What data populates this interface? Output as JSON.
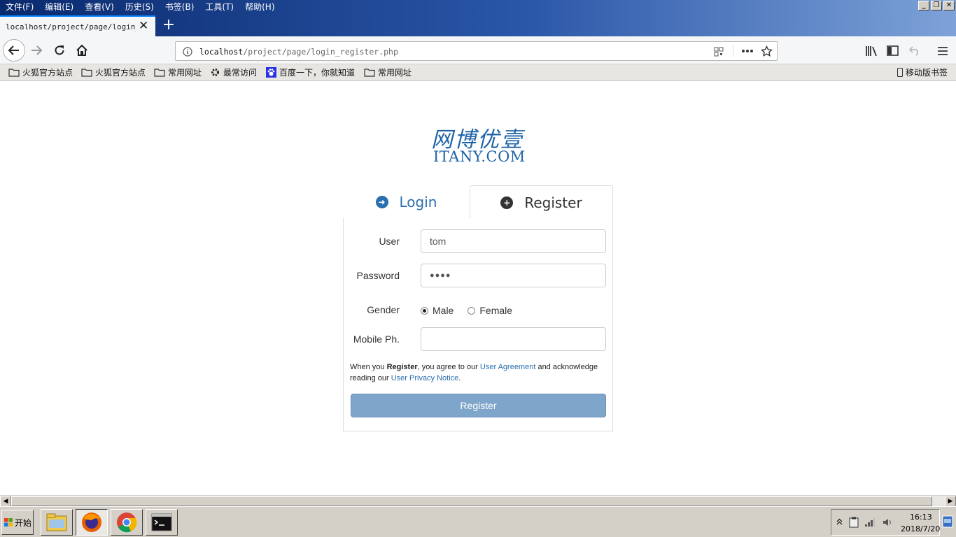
{
  "menu": [
    "文件(F)",
    "编辑(E)",
    "查看(V)",
    "历史(S)",
    "书签(B)",
    "工具(T)",
    "帮助(H)"
  ],
  "tab": {
    "title": "localhost/project/page/login_re",
    "close": "✕",
    "new": "+"
  },
  "url": {
    "host": "localhost",
    "path": "/project/page/login_register.php"
  },
  "bookmarks": [
    "火狐官方站点",
    "火狐官方站点",
    "常用网址",
    "最常访问",
    "百度一下，你就知道",
    "常用网址"
  ],
  "mobile_bookmarks": "移动版书签",
  "logo": {
    "cn": "网博优壹",
    "en": "ITANY.COM"
  },
  "tabs": {
    "login": "Login",
    "register": "Register"
  },
  "form": {
    "user_label": "User",
    "user_value": "tom",
    "password_label": "Password",
    "password_value": "●●●●",
    "gender_label": "Gender",
    "gender_male": "Male",
    "gender_female": "Female",
    "mobile_label": "Mobile Ph.",
    "mobile_value": "",
    "agree_pre": "When you ",
    "agree_bold": "Register",
    "agree_mid": ", you agree to our ",
    "agree_link1": "User Agreement",
    "agree_mid2": " and acknowledge reading our ",
    "agree_link2": "User Privacy Notice",
    "agree_end": ".",
    "submit": "Register"
  },
  "taskbar": {
    "start": "开始",
    "time": "16:13",
    "date": "2018/7/20"
  },
  "colors": {
    "accent": "#1e63a8",
    "button": "#7ea6ca",
    "titlebar": "#0a2a6e"
  }
}
